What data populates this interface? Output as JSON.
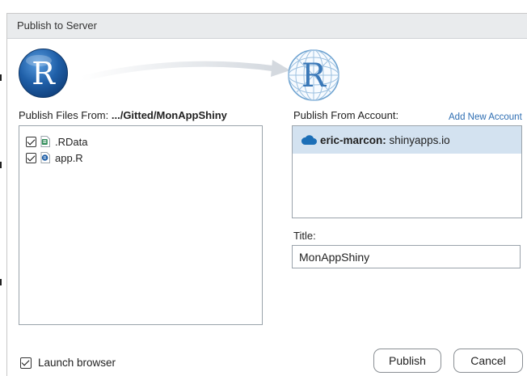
{
  "dialog": {
    "title": "Publish to Server"
  },
  "logos": {
    "source_letter": "R",
    "destination_letter": "R"
  },
  "files": {
    "label_prefix": "Publish Files From: ",
    "path": ".../Gitted/MonAppShiny",
    "items": [
      {
        "name": ".RData",
        "checked": true,
        "icon": "rdata-file-icon"
      },
      {
        "name": "app.R",
        "checked": true,
        "icon": "r-file-icon"
      }
    ]
  },
  "account": {
    "label": "Publish From Account:",
    "add_link": "Add New Account",
    "items": [
      {
        "user": "eric-marcon:",
        "server": " shinyapps.io",
        "selected": true,
        "icon": "cloud-icon"
      }
    ]
  },
  "title_field": {
    "label": "Title:",
    "value": "MonAppShiny"
  },
  "launch_browser": {
    "label": "Launch browser",
    "checked": true
  },
  "buttons": {
    "publish": "Publish",
    "cancel": "Cancel"
  },
  "colors": {
    "accent": "#2d6db2",
    "selection": "#d3e2f0",
    "r_logo_blue": "#1f5fa8",
    "cloud_blue": "#1c6fb7"
  }
}
